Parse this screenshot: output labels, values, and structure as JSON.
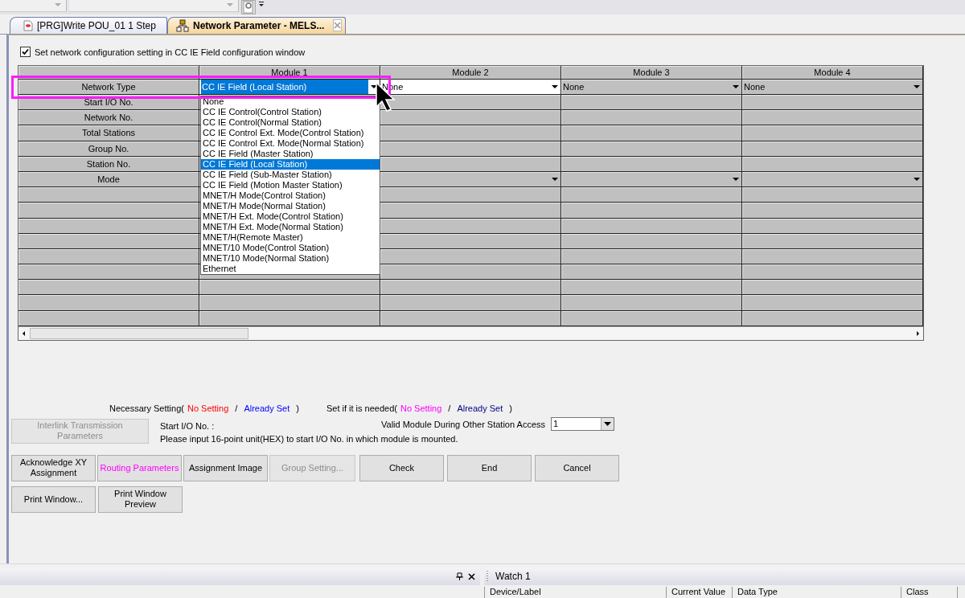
{
  "tabs": [
    {
      "label": "[PRG]Write POU_01 1 Step",
      "selected": false,
      "kind": "program"
    },
    {
      "label": "Network Parameter - MELS...",
      "selected": true,
      "kind": "network"
    }
  ],
  "config_checkbox": {
    "label": "Set network configuration setting in CC IE Field configuration window",
    "checked": true
  },
  "grid": {
    "columns": [
      "Module 1",
      "Module 2",
      "Module 3",
      "Module 4"
    ],
    "rows": [
      {
        "label": "Network Type",
        "cells": [
          {
            "kind": "combo",
            "value": "CC IE Field (Local Station)",
            "focused": true,
            "disabled": false
          },
          {
            "kind": "combo",
            "value": "None",
            "focused": false,
            "disabled": false
          },
          {
            "kind": "combo",
            "value": "None",
            "focused": false,
            "disabled": true
          },
          {
            "kind": "combo",
            "value": "None",
            "focused": false,
            "disabled": true
          }
        ]
      },
      {
        "label": "Start I/O No.",
        "cells": [
          {
            "kind": "plain"
          },
          {
            "kind": "plain"
          },
          {
            "kind": "plain"
          },
          {
            "kind": "plain"
          }
        ]
      },
      {
        "label": "Network No.",
        "cells": [
          {
            "kind": "plain"
          },
          {
            "kind": "plain"
          },
          {
            "kind": "plain"
          },
          {
            "kind": "plain"
          }
        ]
      },
      {
        "label": "Total Stations",
        "cells": [
          {
            "kind": "plain"
          },
          {
            "kind": "plain"
          },
          {
            "kind": "plain"
          },
          {
            "kind": "plain"
          }
        ]
      },
      {
        "label": "Group No.",
        "cells": [
          {
            "kind": "plain"
          },
          {
            "kind": "plain"
          },
          {
            "kind": "plain"
          },
          {
            "kind": "plain"
          }
        ]
      },
      {
        "label": "Station No.",
        "cells": [
          {
            "kind": "plain"
          },
          {
            "kind": "plain"
          },
          {
            "kind": "plain"
          },
          {
            "kind": "plain"
          }
        ]
      },
      {
        "label": "Mode",
        "cells": [
          {
            "kind": "plain"
          },
          {
            "kind": "combo",
            "focused": false,
            "disabled": true
          },
          {
            "kind": "combo",
            "focused": false,
            "disabled": true
          },
          {
            "kind": "combo",
            "focused": false,
            "disabled": true
          }
        ]
      },
      {
        "cells": [
          {
            "kind": "plain"
          },
          {
            "kind": "plain"
          },
          {
            "kind": "plain"
          },
          {
            "kind": "plain"
          }
        ]
      },
      {
        "cells": [
          {
            "kind": "plain"
          },
          {
            "kind": "plain"
          },
          {
            "kind": "plain"
          },
          {
            "kind": "plain"
          }
        ]
      },
      {
        "cells": [
          {
            "kind": "plain"
          },
          {
            "kind": "plain"
          },
          {
            "kind": "plain"
          },
          {
            "kind": "plain"
          }
        ]
      },
      {
        "cells": [
          {
            "kind": "plain"
          },
          {
            "kind": "plain"
          },
          {
            "kind": "plain"
          },
          {
            "kind": "plain"
          }
        ]
      },
      {
        "cells": [
          {
            "kind": "plain"
          },
          {
            "kind": "plain"
          },
          {
            "kind": "plain"
          },
          {
            "kind": "plain"
          }
        ]
      },
      {
        "cells": [
          {
            "kind": "plain"
          },
          {
            "kind": "plain"
          },
          {
            "kind": "plain"
          },
          {
            "kind": "plain"
          }
        ]
      },
      {
        "cells": [
          {
            "kind": "plain"
          },
          {
            "kind": "plain"
          },
          {
            "kind": "plain"
          },
          {
            "kind": "plain"
          }
        ]
      },
      {
        "cells": [
          {
            "kind": "plain"
          },
          {
            "kind": "plain"
          },
          {
            "kind": "plain"
          },
          {
            "kind": "plain"
          }
        ]
      },
      {
        "cells": [
          {
            "kind": "plain"
          },
          {
            "kind": "plain"
          },
          {
            "kind": "plain"
          },
          {
            "kind": "plain"
          }
        ]
      }
    ]
  },
  "dropdown": {
    "options": [
      {
        "label": "None",
        "selected": false
      },
      {
        "label": "CC IE Control(Control Station)",
        "selected": false
      },
      {
        "label": "CC IE Control(Normal Station)",
        "selected": false
      },
      {
        "label": "CC IE Control Ext. Mode(Control Station)",
        "selected": false
      },
      {
        "label": "CC IE Control Ext. Mode(Normal Station)",
        "selected": false
      },
      {
        "label": "CC IE Field (Master Station)",
        "selected": false
      },
      {
        "label": "CC IE Field (Local Station)",
        "selected": true
      },
      {
        "label": "CC IE Field (Sub-Master Station)",
        "selected": false
      },
      {
        "label": "CC IE Field (Motion Master Station)",
        "selected": false
      },
      {
        "label": "MNET/H Mode(Control Station)",
        "selected": false
      },
      {
        "label": "MNET/H Mode(Normal Station)",
        "selected": false
      },
      {
        "label": "MNET/H Ext. Mode(Control Station)",
        "selected": false
      },
      {
        "label": "MNET/H Ext. Mode(Normal Station)",
        "selected": false
      },
      {
        "label": "MNET/H(Remote Master)",
        "selected": false
      },
      {
        "label": "MNET/10 Mode(Control Station)",
        "selected": false
      },
      {
        "label": "MNET/10 Mode(Normal Station)",
        "selected": false
      },
      {
        "label": "Ethernet",
        "selected": false
      }
    ]
  },
  "legend": [
    {
      "label": "Necessary Setting(",
      "items": [
        {
          "text": "No Setting",
          "color": "#ff0000"
        },
        {
          "text": "Already Set",
          "color": "#0000ff"
        }
      ],
      "separator": "/",
      "close": ")"
    },
    {
      "label": "Set if it is needed(",
      "items": [
        {
          "text": "No Setting",
          "color": "#ff00ff"
        },
        {
          "text": "Already Set",
          "color": "#000080"
        }
      ],
      "separator": "/",
      "close": ")"
    }
  ],
  "interlink_button": {
    "label": "Interlink Transmission Parameters",
    "disabled": true
  },
  "start_io": {
    "label": "Start I/O No. :",
    "hint": "Please input 16-point unit(HEX) to start I/O No. in which module is mounted."
  },
  "valid_module": {
    "label": "Valid Module During Other Station Access",
    "value": "1"
  },
  "button_rows": [
    [
      {
        "label": "Acknowledge XY Assignment",
        "disabled": false,
        "highlighted": false
      },
      {
        "label": "Routing Parameters",
        "disabled": false,
        "highlighted": true
      },
      {
        "label": "Assignment Image",
        "disabled": false,
        "highlighted": false
      },
      {
        "label": "Group Setting...",
        "disabled": true,
        "highlighted": false
      },
      {
        "label": "Check",
        "disabled": false,
        "highlighted": false
      },
      {
        "label": "End",
        "disabled": false,
        "highlighted": false
      },
      {
        "label": "Cancel",
        "disabled": false,
        "highlighted": false
      }
    ],
    [
      {
        "label": "Print Window...",
        "disabled": false,
        "highlighted": false
      },
      {
        "label": "Print Window Preview",
        "disabled": false,
        "highlighted": false
      }
    ]
  ],
  "watch": {
    "title": "Watch 1",
    "columns": [
      "Device/Label",
      "Current Value",
      "Data Type",
      "Class"
    ]
  }
}
